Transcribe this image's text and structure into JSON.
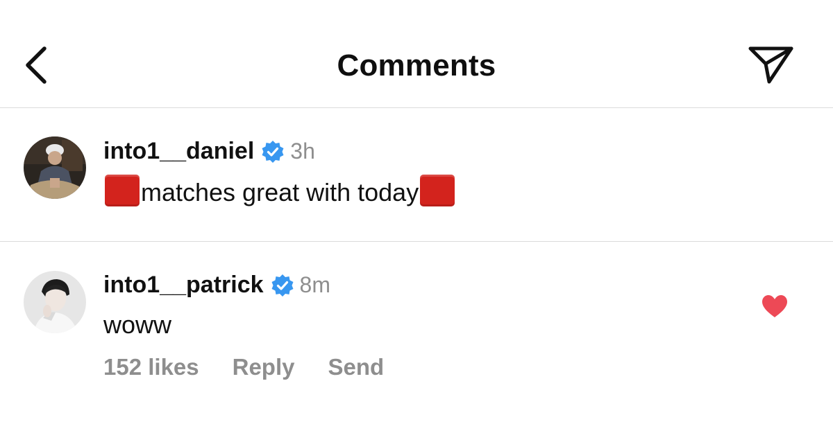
{
  "header": {
    "title": "Comments",
    "back_icon": "chevron-left-icon",
    "send_icon": "paper-plane-icon"
  },
  "comments": [
    {
      "username": "into1__daniel",
      "verified": true,
      "time": "3h",
      "text": "matches great with today",
      "emoji_icon": "red-square-emoji"
    },
    {
      "username": "into1__patrick",
      "verified": true,
      "time": "8m",
      "text": "woww",
      "likes_label": "152 likes",
      "reply_label": "Reply",
      "send_label": "Send",
      "liked": true,
      "heart_color": "#ed4956"
    }
  ],
  "colors": {
    "verified_blue": "#3897f0",
    "secondary_text": "#8e8e8e",
    "divider": "#dbdbdb",
    "red_square": "#d3231d"
  }
}
